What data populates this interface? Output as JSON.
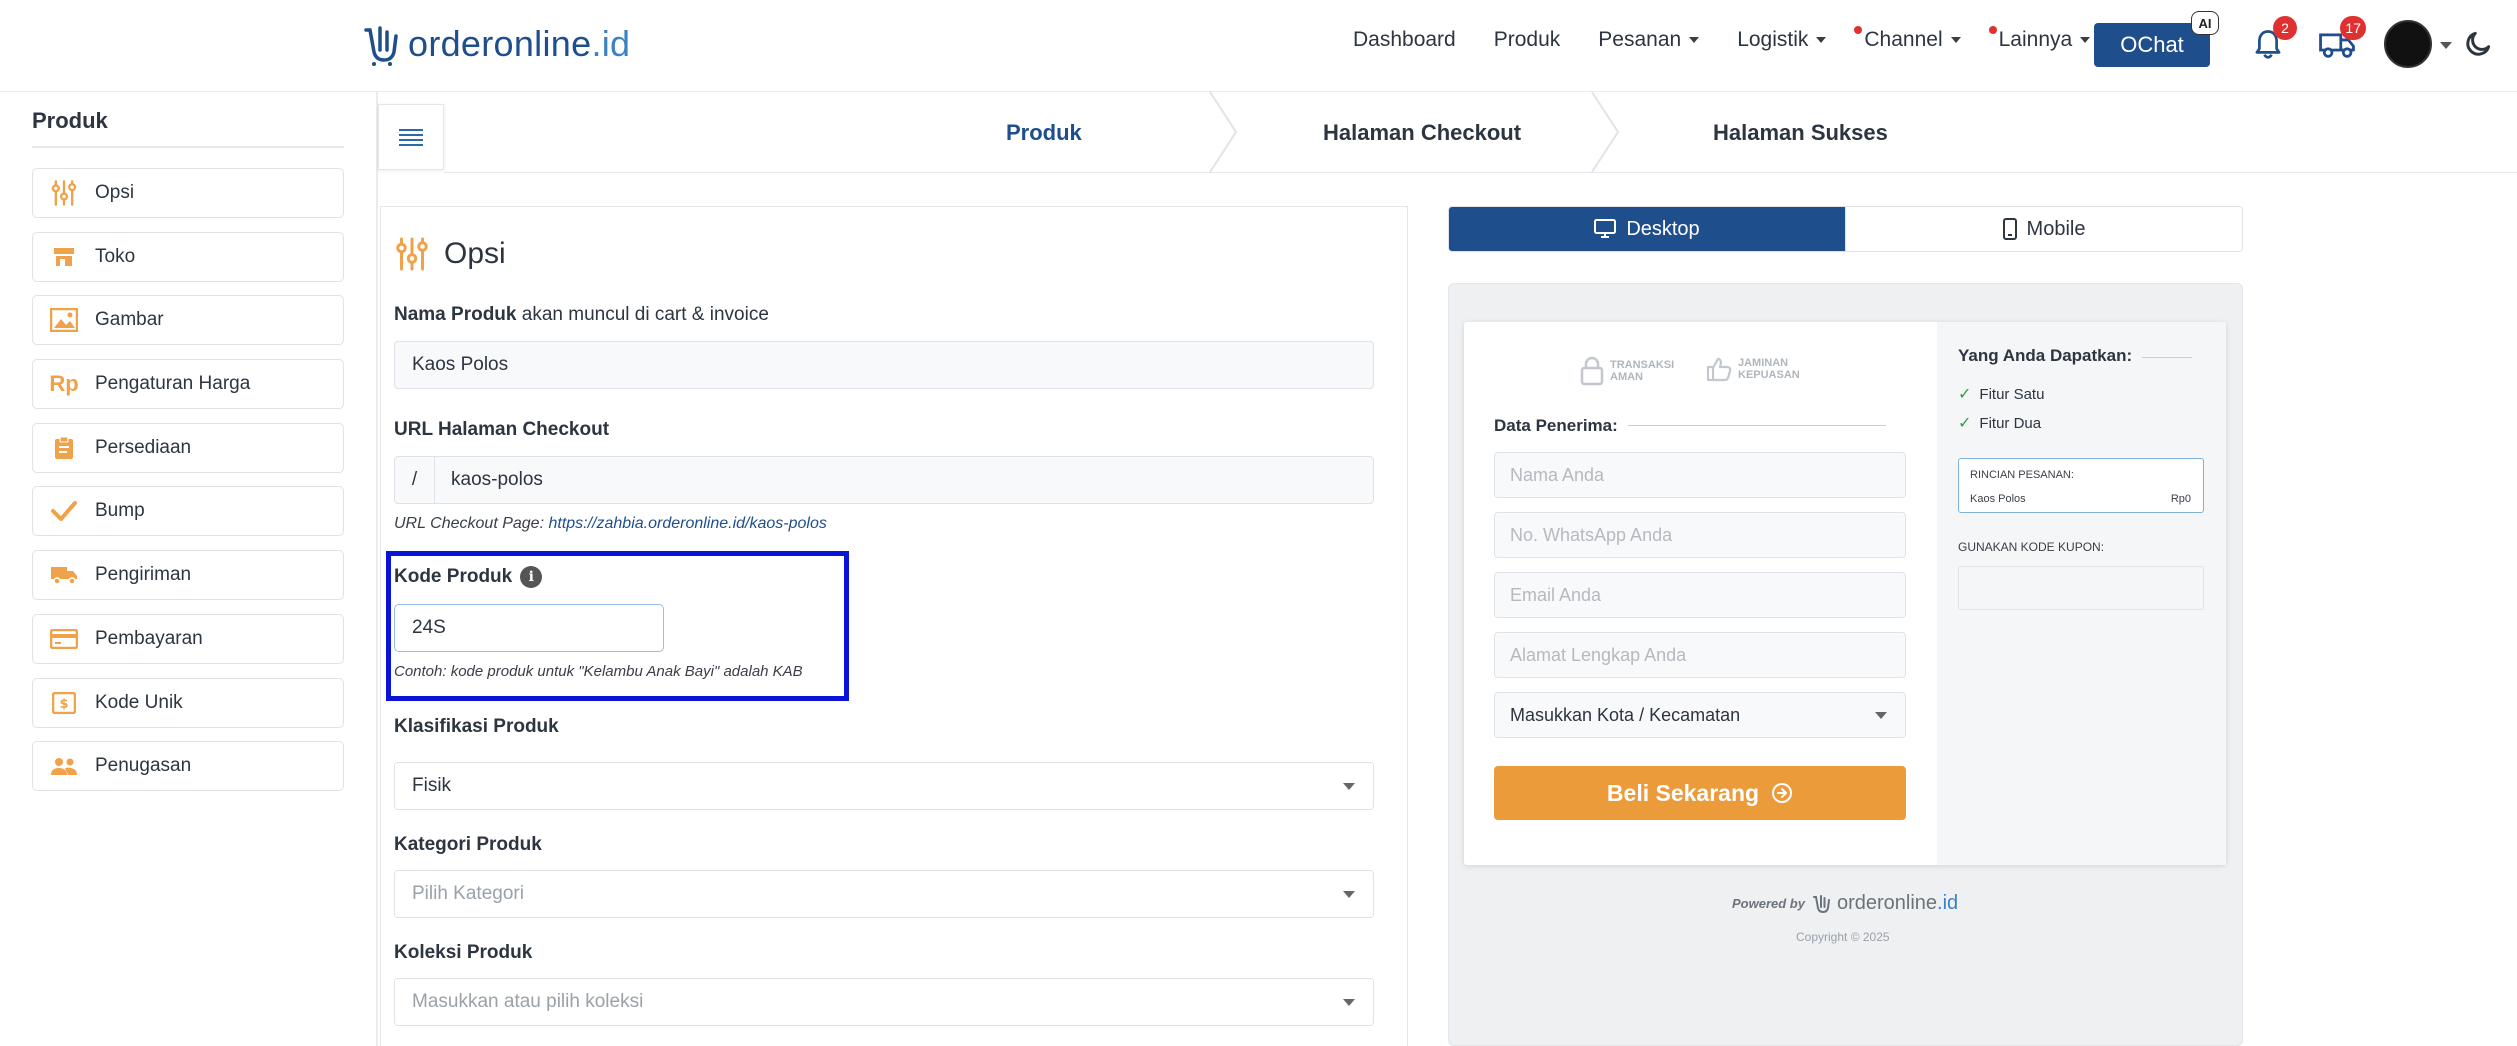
{
  "brand": {
    "name_main": "orderonline",
    "name_tld": ".id"
  },
  "nav": {
    "items": [
      {
        "label": "Dashboard",
        "has_caret": false,
        "dot": false
      },
      {
        "label": "Produk",
        "has_caret": false,
        "dot": false
      },
      {
        "label": "Pesanan",
        "has_caret": true,
        "dot": false
      },
      {
        "label": "Logistik",
        "has_caret": true,
        "dot": false
      },
      {
        "label": "Channel",
        "has_caret": true,
        "dot": true
      },
      {
        "label": "Lainnya",
        "has_caret": true,
        "dot": true
      }
    ],
    "ochat_label": "OChat",
    "ai_badge": "AI",
    "notif_count": "2",
    "delivery_count": "17"
  },
  "sidebar": {
    "title": "Produk",
    "items": [
      {
        "label": "Opsi",
        "icon": "sliders-icon"
      },
      {
        "label": "Toko",
        "icon": "store-icon"
      },
      {
        "label": "Gambar",
        "icon": "image-icon"
      },
      {
        "label": "Pengaturan Harga",
        "icon": "rupiah-icon"
      },
      {
        "label": "Persediaan",
        "icon": "clipboard-icon"
      },
      {
        "label": "Bump",
        "icon": "check-icon"
      },
      {
        "label": "Pengiriman",
        "icon": "truck-icon"
      },
      {
        "label": "Pembayaran",
        "icon": "credit-card-icon"
      },
      {
        "label": "Kode Unik",
        "icon": "money-icon"
      },
      {
        "label": "Penugasan",
        "icon": "users-icon"
      }
    ]
  },
  "steps": [
    "Produk",
    "Halaman Checkout",
    "Halaman Sukses"
  ],
  "form": {
    "section_title": "Opsi",
    "nama_label_bold": "Nama Produk",
    "nama_label_rest": " akan muncul di cart & invoice",
    "nama_value": "Kaos Polos",
    "url_label": "URL Halaman Checkout",
    "url_prefix": "/",
    "url_value": "kaos-polos",
    "url_hint_prefix": "URL Checkout Page: ",
    "url_hint_link": "https://zahbia.orderonline.id/kaos-polos",
    "kode_label": "Kode Produk",
    "kode_value": "24S",
    "kode_hint": "Contoh: kode produk untuk \"Kelambu Anak Bayi\" adalah KAB",
    "klasifikasi_label": "Klasifikasi Produk",
    "klasifikasi_value": "Fisik",
    "kategori_label": "Kategori Produk",
    "kategori_placeholder": "Pilih Kategori",
    "koleksi_label": "Koleksi Produk",
    "koleksi_placeholder": "Masukkan atau pilih koleksi"
  },
  "preview": {
    "toggle_desktop": "Desktop",
    "toggle_mobile": "Mobile",
    "trust_1_line1": "TRANSAKSI",
    "trust_1_line2": "AMAN",
    "trust_2_line1": "JAMINAN",
    "trust_2_line2": "KEPUASAN",
    "data_label": "Data Penerima:",
    "inputs": [
      "Nama Anda",
      "No. WhatsApp Anda",
      "Email Anda",
      "Alamat Lengkap Anda"
    ],
    "kota_select": "Masukkan Kota / Kecamatan",
    "buy_button": "Beli Sekarang",
    "get_title": "Yang Anda Dapatkan:",
    "features": [
      "Fitur Satu",
      "Fitur Dua"
    ],
    "rincian_title": "RINCIAN PESANAN:",
    "rincian_item": "Kaos Polos",
    "rincian_price": "Rp0",
    "coupon_label": "GUNAKAN KODE KUPON:",
    "powered_by": "Powered by",
    "copyright": "Copyright © 2025"
  },
  "colors": {
    "brand_blue": "#1f4e8c",
    "accent_orange": "#ec9b3b",
    "highlight_box": "#0a14d6"
  }
}
